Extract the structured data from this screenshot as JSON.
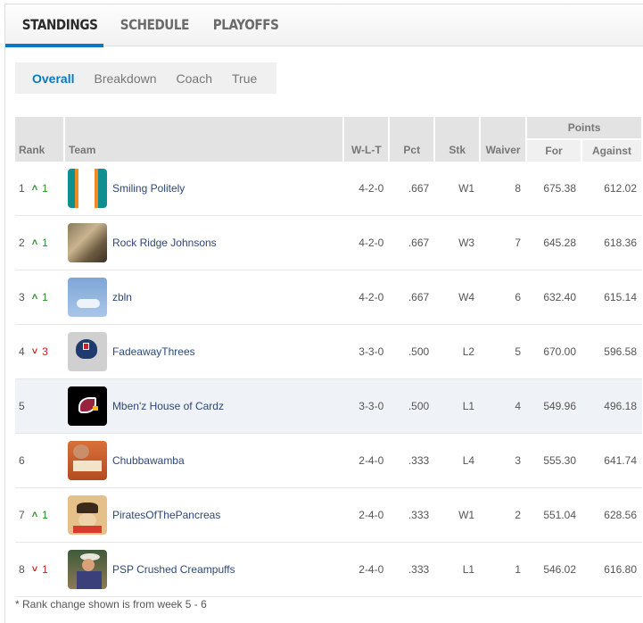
{
  "tabs": [
    {
      "label": "STANDINGS",
      "active": true
    },
    {
      "label": "SCHEDULE",
      "active": false
    },
    {
      "label": "PLAYOFFS",
      "active": false
    }
  ],
  "subtabs": [
    {
      "label": "Overall",
      "active": true
    },
    {
      "label": "Breakdown",
      "active": false
    },
    {
      "label": "Coach",
      "active": false
    },
    {
      "label": "True",
      "active": false
    }
  ],
  "table": {
    "headers": {
      "rank": "Rank",
      "team": "Team",
      "wlt": "W-L-T",
      "pct": "Pct",
      "stk": "Stk",
      "waiver": "Waiver",
      "points_group": "Points",
      "for": "For",
      "against": "Against"
    },
    "rows": [
      {
        "rank": "1",
        "change_dir": "up",
        "change": "1",
        "team": "Smiling Politely",
        "logo": "dolphins-stripes",
        "wlt": "4-2-0",
        "pct": ".667",
        "stk": "W1",
        "waiver": "8",
        "pf": "675.38",
        "pa": "612.02"
      },
      {
        "rank": "2",
        "change_dir": "up",
        "change": "1",
        "team": "Rock Ridge Johnsons",
        "logo": "photo-two-men",
        "wlt": "4-2-0",
        "pct": ".667",
        "stk": "W3",
        "waiver": "7",
        "pf": "645.28",
        "pa": "618.36"
      },
      {
        "rank": "3",
        "change_dir": "up",
        "change": "1",
        "team": "zbln",
        "logo": "photo-sky-clouds",
        "wlt": "4-2-0",
        "pct": ".667",
        "stk": "W4",
        "waiver": "6",
        "pf": "632.40",
        "pa": "615.14"
      },
      {
        "rank": "4",
        "change_dir": "down",
        "change": "3",
        "team": "FadeawayThrees",
        "logo": "nfl-helmet",
        "wlt": "3-3-0",
        "pct": ".500",
        "stk": "L2",
        "waiver": "5",
        "pf": "670.00",
        "pa": "596.58"
      },
      {
        "rank": "5",
        "change_dir": "none",
        "change": "",
        "team": "Mben'z House of Cardz",
        "logo": "cardinals",
        "wlt": "3-3-0",
        "pct": ".500",
        "stk": "L1",
        "waiver": "4",
        "pf": "549.96",
        "pa": "496.18",
        "highlighted": true
      },
      {
        "rank": "6",
        "change_dir": "none",
        "change": "",
        "team": "Chubbawamba",
        "logo": "photo-fan-sign",
        "wlt": "2-4-0",
        "pct": ".333",
        "stk": "L4",
        "waiver": "3",
        "pf": "555.30",
        "pa": "641.74"
      },
      {
        "rank": "7",
        "change_dir": "up",
        "change": "1",
        "team": "PiratesOfThePancreas",
        "logo": "pirate-cartoon",
        "wlt": "2-4-0",
        "pct": ".333",
        "stk": "W1",
        "waiver": "2",
        "pf": "551.04",
        "pa": "628.56"
      },
      {
        "rank": "8",
        "change_dir": "down",
        "change": "1",
        "team": "PSP Crushed Creampuffs",
        "logo": "photo-man-hat",
        "wlt": "2-4-0",
        "pct": ".333",
        "stk": "L1",
        "waiver": "1",
        "pf": "546.02",
        "pa": "616.80"
      }
    ]
  },
  "footnote": "* Rank change shown is from week 5 - 6",
  "colors": {
    "accent": "#0a79c3",
    "up": "#2a8a2a",
    "down": "#cc1f1f",
    "team_link": "#2d4778"
  }
}
